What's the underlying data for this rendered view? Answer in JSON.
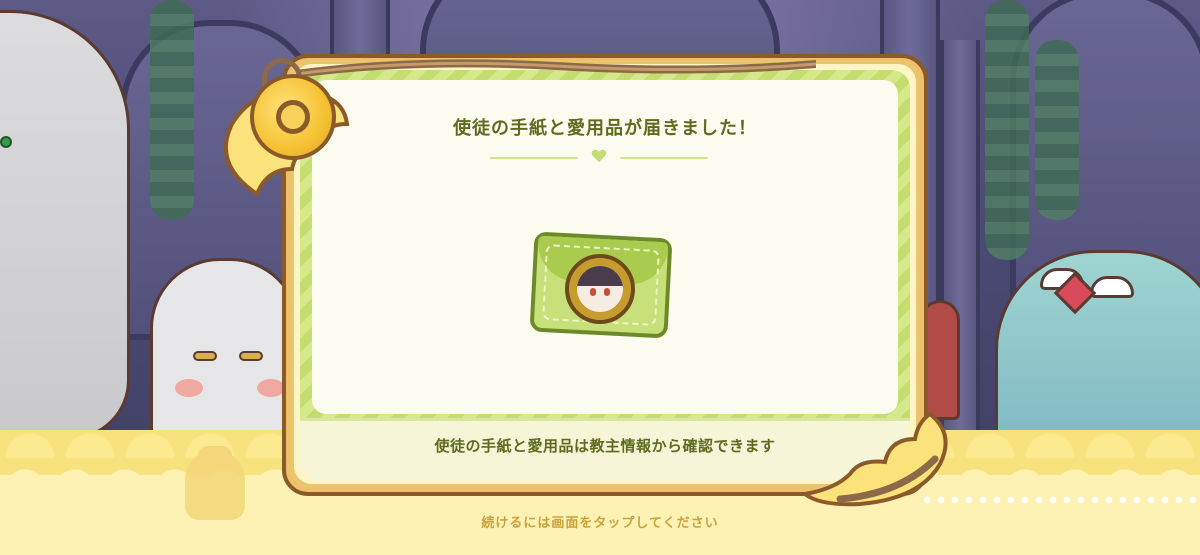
{
  "dialog": {
    "title": "使徒の手紙と愛用品が届きました！",
    "footer_message": "使徒の手紙と愛用品は教主情報から確認できます"
  },
  "prompt": {
    "tap_to_continue": "続けるには画面をタップしてください"
  },
  "icons": {
    "envelope": "letter-envelope-icon",
    "avatar": "character-portrait-icon",
    "divider": "heart-icon"
  },
  "colors": {
    "title_text": "#5e6b1f",
    "panel_bg": "#fcfbef",
    "band_yellow": "#f8e27e",
    "envelope_green": "#c8e07a",
    "tap_text": "#c9a23a"
  }
}
